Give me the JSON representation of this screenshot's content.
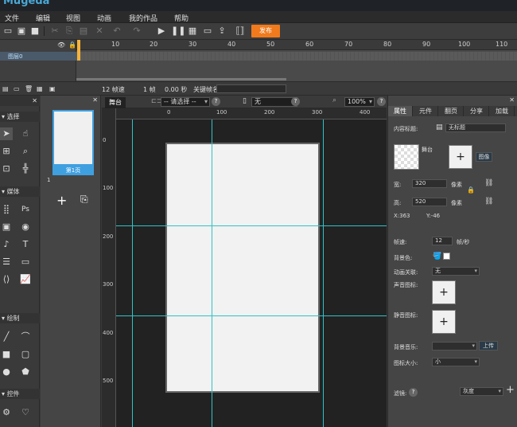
{
  "brand": "Mugeda",
  "menu": [
    "文件",
    "编辑",
    "视图",
    "动画",
    "我的作品",
    "帮助"
  ],
  "toolbar": {
    "icons": [
      "new-icon",
      "open-icon",
      "save-icon",
      "cut-icon",
      "copy-icon",
      "paste-icon",
      "delete-icon",
      "undo-icon",
      "redo-icon",
      "play-icon",
      "pause-icon",
      "preview-icon",
      "device-preview-icon",
      "export-icon",
      "code-icon"
    ],
    "publish_label": "发布"
  },
  "timeline": {
    "ticks": [
      "10",
      "20",
      "30",
      "40",
      "50",
      "60",
      "70",
      "80",
      "90",
      "100",
      "110"
    ],
    "layer_name": "图层0"
  },
  "status": {
    "fps": "12 帧速",
    "frame": "1 帧",
    "time": "0.00 秒",
    "keyframe_label": "关键帧名"
  },
  "tools": {
    "select_label": "选择",
    "media_label": "媒体",
    "draw_label": "绘制",
    "control_label": "控件"
  },
  "pages": {
    "page1_label": "第1页",
    "page_num": "1"
  },
  "stage": {
    "tab_label": "舞台",
    "select_placeholder": "-- 请选择 --",
    "device_value": "无",
    "zoom": "100%",
    "h_ruler": [
      "0",
      "100",
      "200",
      "300",
      "400"
    ],
    "v_ruler": [
      "0",
      "100",
      "200",
      "300",
      "400",
      "500"
    ]
  },
  "props": {
    "tabs": [
      "属性",
      "元件",
      "翻页",
      "分享",
      "加载"
    ],
    "content_title_label": "内容标题:",
    "content_title_value": "无标题",
    "stage_label": "舞台",
    "image_btn": "图像",
    "width_label": "宽:",
    "width_value": "320",
    "height_label": "高:",
    "height_value": "520",
    "px_unit": "像素",
    "x_label": "X:363",
    "y_label": "Y:-46",
    "fps_label": "帧速:",
    "fps_value": "12",
    "fps_unit": "帧/秒",
    "bgcolor_label": "背景色:",
    "anim_link_label": "动画关联:",
    "anim_link_value": "无",
    "sound_icon_label": "声音图标:",
    "mute_icon_label": "静音图标:",
    "bg_music_label": "背景音乐:",
    "upload_label": "上传",
    "icon_size_label": "图标大小:",
    "icon_size_value": "小",
    "filter_label": "滤镜:",
    "filter_value": "灰度"
  }
}
